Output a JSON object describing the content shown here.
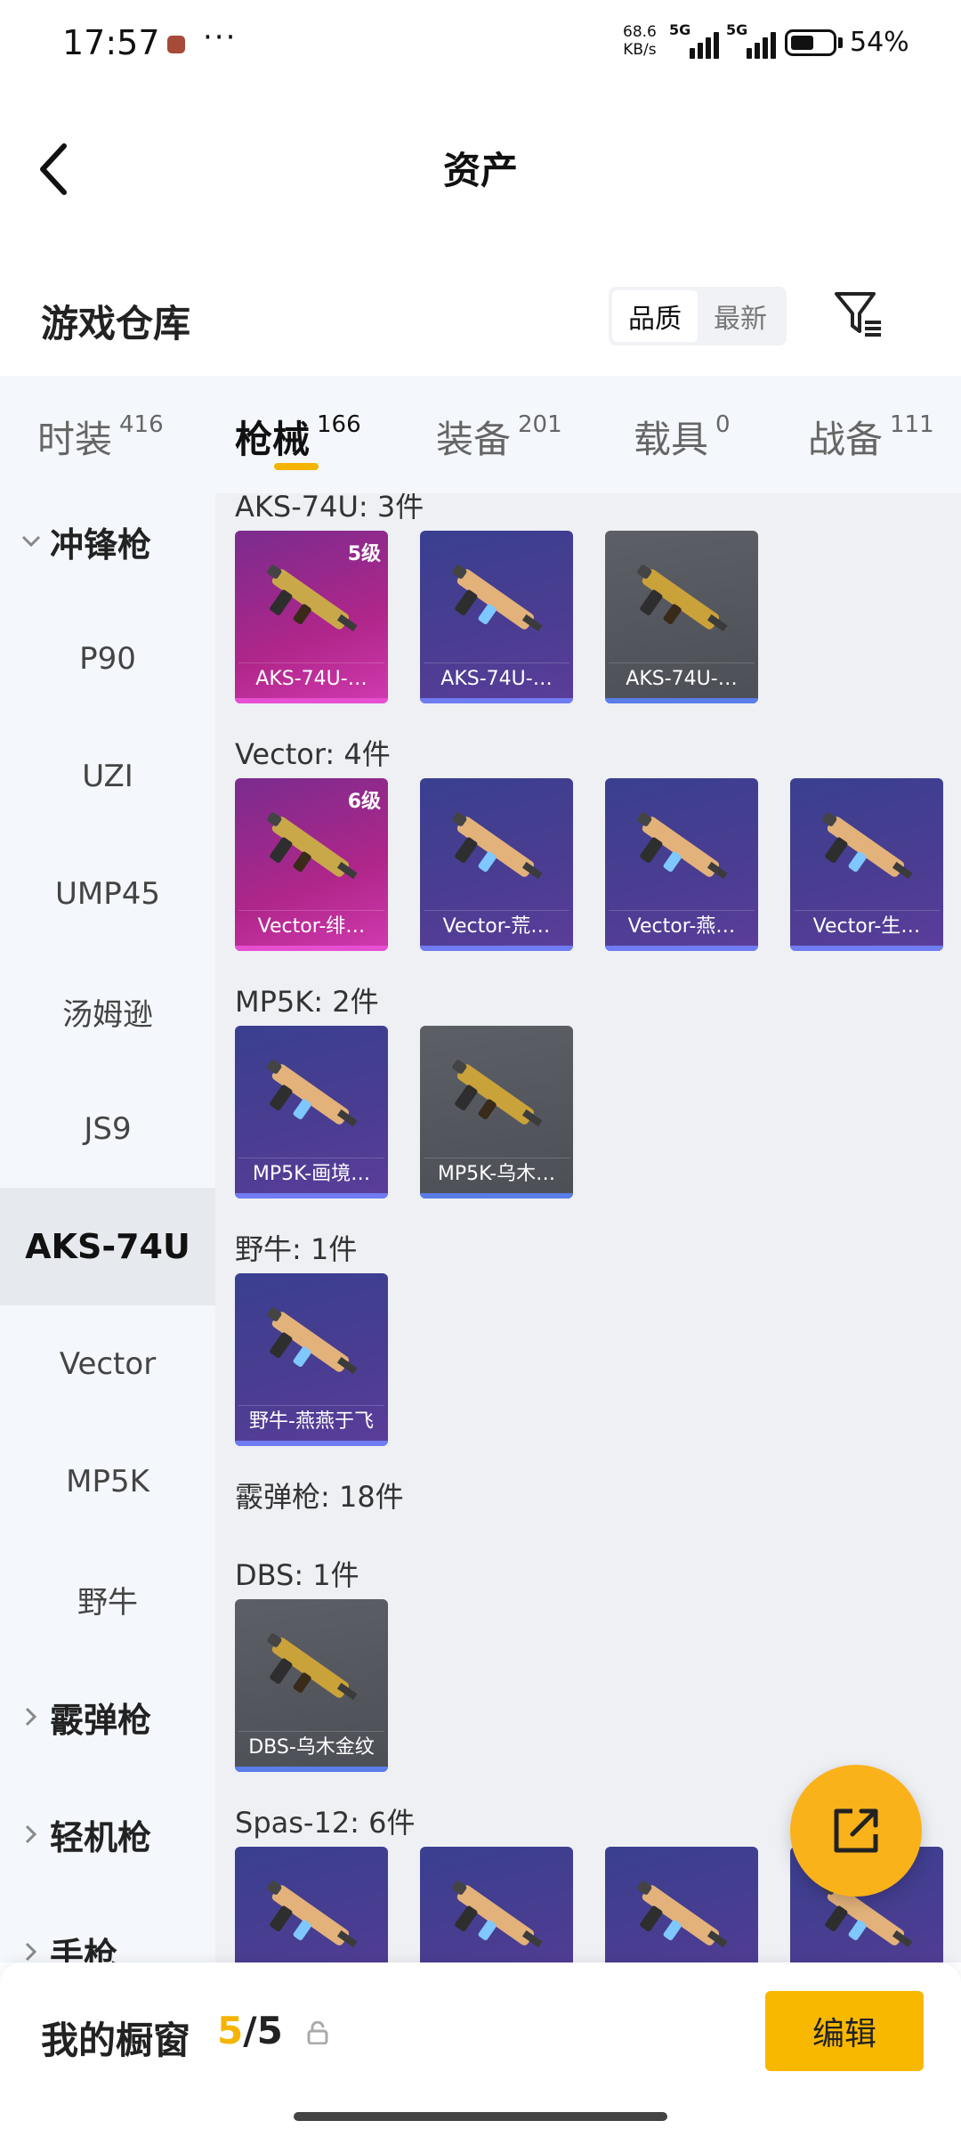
{
  "status_bar": {
    "time": "17:57",
    "speed_value": "68.6",
    "speed_unit": "KB/s",
    "network_1": "5G",
    "network_2": "5G",
    "battery_level": 0.54,
    "battery_text": "54%"
  },
  "header": {
    "title": "资产"
  },
  "warehouse": {
    "title": "游戏仓库",
    "sort_options": [
      "品质",
      "最新"
    ],
    "active_sort": "品质"
  },
  "tabs": [
    {
      "label": "时装",
      "count": "416"
    },
    {
      "label": "枪械",
      "count": "166"
    },
    {
      "label": "装备",
      "count": "201"
    },
    {
      "label": "载具",
      "count": "0"
    },
    {
      "label": "战备",
      "count": "111"
    }
  ],
  "active_tab": "枪械",
  "sidebar": {
    "items": [
      {
        "label": "冲锋枪",
        "kind": "group-expanded"
      },
      {
        "label": "P90",
        "kind": "sub"
      },
      {
        "label": "UZI",
        "kind": "sub"
      },
      {
        "label": "UMP45",
        "kind": "sub"
      },
      {
        "label": "汤姆逊",
        "kind": "sub"
      },
      {
        "label": "JS9",
        "kind": "sub"
      },
      {
        "label": "AKS-74U",
        "kind": "sub-selected"
      },
      {
        "label": "Vector",
        "kind": "sub"
      },
      {
        "label": "MP5K",
        "kind": "sub"
      },
      {
        "label": "野牛",
        "kind": "sub"
      },
      {
        "label": "霰弹枪",
        "kind": "group-collapsed"
      },
      {
        "label": "轻机枪",
        "kind": "group-collapsed"
      },
      {
        "label": "手枪",
        "kind": "group-collapsed"
      }
    ]
  },
  "sections": [
    {
      "label": "AKS-74U: 3件",
      "cards": [
        {
          "name": "AKS-74U-…",
          "level": "5级",
          "rarity": "pink"
        },
        {
          "name": "AKS-74U-…",
          "level": "",
          "rarity": "blue"
        },
        {
          "name": "AKS-74U-…",
          "level": "",
          "rarity": "gray"
        }
      ]
    },
    {
      "label": "Vector: 4件",
      "cards": [
        {
          "name": "Vector-绯…",
          "level": "6级",
          "rarity": "pink"
        },
        {
          "name": "Vector-荒…",
          "level": "",
          "rarity": "blue"
        },
        {
          "name": "Vector-燕…",
          "level": "",
          "rarity": "blue"
        },
        {
          "name": "Vector-生…",
          "level": "",
          "rarity": "blue"
        }
      ]
    },
    {
      "label": "MP5K: 2件",
      "cards": [
        {
          "name": "MP5K-画境…",
          "level": "",
          "rarity": "blue"
        },
        {
          "name": "MP5K-乌木…",
          "level": "",
          "rarity": "gray"
        }
      ]
    },
    {
      "label": "野牛: 1件",
      "cards": [
        {
          "name": "野牛-燕燕于飞",
          "level": "",
          "rarity": "blue"
        }
      ]
    },
    {
      "label": "霰弹枪: 18件",
      "cards": []
    },
    {
      "label": "DBS: 1件",
      "cards": [
        {
          "name": "DBS-乌木金纹",
          "level": "",
          "rarity": "gray"
        }
      ]
    },
    {
      "label": "Spas-12: 6件",
      "cards": [
        {
          "name": "",
          "level": "",
          "rarity": "blue"
        },
        {
          "name": "",
          "level": "",
          "rarity": "blue"
        },
        {
          "name": "",
          "level": "",
          "rarity": "blue"
        },
        {
          "name": "",
          "level": "",
          "rarity": "blue"
        }
      ]
    }
  ],
  "bottom_bar": {
    "label": "我的橱窗",
    "current": "5",
    "total": "/5",
    "edit_label": "编辑"
  },
  "colors": {
    "accent": "#f9b800",
    "rarity_pink": "#e64fd1",
    "rarity_blue": "#6f7cf2",
    "rarity_gray": "#5a7de8"
  },
  "icons": [
    "back-arrow-icon",
    "filter-icon",
    "chevron-down-icon",
    "chevron-right-icon",
    "share-icon",
    "lock-icon"
  ]
}
